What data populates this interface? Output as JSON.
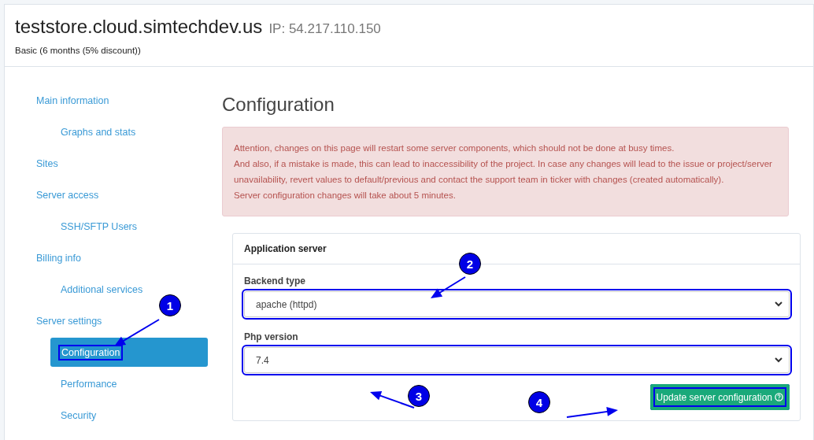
{
  "header": {
    "domain": "teststore.cloud.simtechdev.us",
    "ip": "IP: 54.217.110.150",
    "plan": "Basic (6 months (5% discount))"
  },
  "sidebar": {
    "items": [
      {
        "label": "Main information",
        "selected": false,
        "highlighted": false,
        "children": [
          {
            "label": "Graphs and stats",
            "selected": false,
            "highlighted": false
          }
        ]
      },
      {
        "label": "Sites",
        "selected": false,
        "highlighted": false
      },
      {
        "label": "Server access",
        "selected": false,
        "highlighted": false,
        "children": [
          {
            "label": "SSH/SFTP Users",
            "selected": false,
            "highlighted": false
          }
        ]
      },
      {
        "label": "Billing info",
        "selected": false,
        "highlighted": false,
        "children": [
          {
            "label": "Additional services",
            "selected": false,
            "highlighted": false
          }
        ]
      },
      {
        "label": "Server settings",
        "selected": false,
        "highlighted": false,
        "children": [
          {
            "label": "Configuration",
            "selected": true,
            "highlighted": true
          },
          {
            "label": "Performance",
            "selected": false,
            "highlighted": false
          },
          {
            "label": "Security",
            "selected": false,
            "highlighted": false
          }
        ]
      }
    ]
  },
  "page_title": "Configuration",
  "alert": {
    "lines": [
      "Attention, changes on this page will restart some server components, which should not be done at busy times.",
      "And also, if a mistake is made, this can lead to inaccessibility of the project. In case any changes will lead to the issue or project/server unavailability, revert values to default/previous and contact the support team in ticker with changes (created automatically).",
      "Server configuration changes will take about 5 minutes."
    ]
  },
  "panel": {
    "title": "Application server",
    "fields": [
      {
        "label": "Backend type",
        "value": "apache (httpd)",
        "highlighted": true
      },
      {
        "label": "Php version",
        "value": "7.4",
        "highlighted": true
      }
    ],
    "button": {
      "label": "Update server configuration",
      "highlighted": true
    }
  },
  "annotations": [
    {
      "label": "1"
    },
    {
      "label": "2"
    },
    {
      "label": "3"
    },
    {
      "label": "4"
    }
  ]
}
